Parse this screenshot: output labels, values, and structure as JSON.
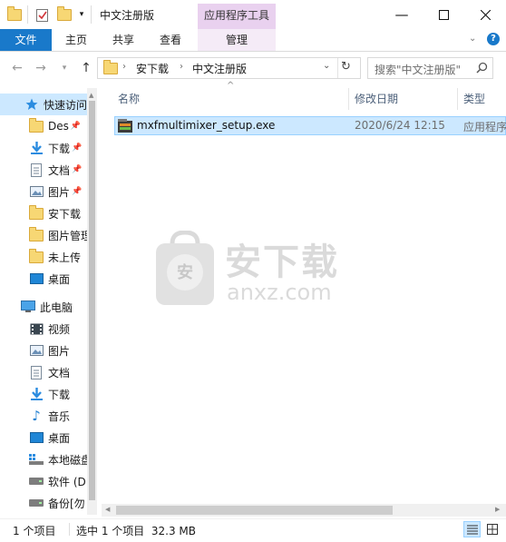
{
  "titlebar": {
    "title": "中文注册版",
    "context_group": "应用程序工具"
  },
  "ribbon": {
    "tabs": [
      {
        "label": "文件"
      },
      {
        "label": "主页"
      },
      {
        "label": "共享"
      },
      {
        "label": "查看"
      },
      {
        "label": "管理"
      }
    ]
  },
  "address": {
    "crumbs": [
      "安下载",
      "中文注册版"
    ]
  },
  "search": {
    "placeholder": "搜索\"中文注册版\""
  },
  "nav": {
    "quick_access": "快速访问",
    "quick_items": [
      {
        "label": "Des"
      },
      {
        "label": "下载"
      },
      {
        "label": "文档"
      },
      {
        "label": "图片"
      },
      {
        "label": "安下载"
      },
      {
        "label": "图片管理"
      },
      {
        "label": "未上传"
      },
      {
        "label": "桌面"
      }
    ],
    "this_pc": "此电脑",
    "pc_items": [
      {
        "label": "视频"
      },
      {
        "label": "图片"
      },
      {
        "label": "文档"
      },
      {
        "label": "下载"
      },
      {
        "label": "音乐"
      },
      {
        "label": "桌面"
      },
      {
        "label": "本地磁盘"
      },
      {
        "label": "软件 (D"
      },
      {
        "label": "备份[勿"
      }
    ]
  },
  "columns": {
    "name": "名称",
    "modified": "修改日期",
    "type": "类型"
  },
  "files": [
    {
      "name": "mxfmultimixer_setup.exe",
      "modified": "2020/6/24 12:15",
      "type": "应用程序"
    }
  ],
  "watermark": {
    "text": "安下载",
    "domain": "anxz.com",
    "shield_char": "安"
  },
  "status": {
    "count": "1 个项目",
    "selected": "选中 1 个项目  32.3 MB"
  },
  "colors": {
    "accent": "#1979ca",
    "selection": "#cce8ff",
    "context_tab": "#e9d1ef"
  }
}
